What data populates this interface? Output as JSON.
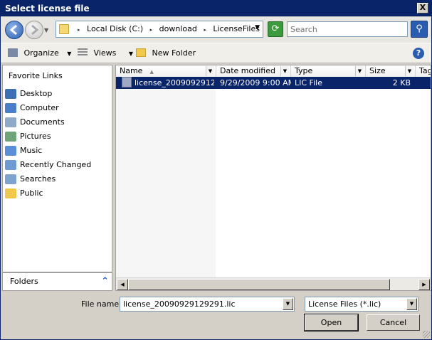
{
  "window": {
    "title": "Select license file",
    "close_label": "X"
  },
  "address": {
    "crumbs": [
      "Local Disk (C:)",
      "download",
      "LicenseFiles"
    ],
    "separator": "▸"
  },
  "search": {
    "placeholder": "Search"
  },
  "toolbar": {
    "organize_label": "Organize",
    "views_label": "Views",
    "new_folder_label": "New Folder",
    "help_label": "?"
  },
  "sidebar": {
    "header": "Favorite Links",
    "items": [
      {
        "label": "Desktop",
        "icon": "desktop-icon",
        "color": "#3d6fb5"
      },
      {
        "label": "Computer",
        "icon": "computer-icon",
        "color": "#4a7ec9"
      },
      {
        "label": "Documents",
        "icon": "documents-icon",
        "color": "#8fa9c7"
      },
      {
        "label": "Pictures",
        "icon": "pictures-icon",
        "color": "#6fa37a"
      },
      {
        "label": "Music",
        "icon": "music-icon",
        "color": "#5b8ed6"
      },
      {
        "label": "Recently Changed",
        "icon": "recently-changed-icon",
        "color": "#6d9ad0"
      },
      {
        "label": "Searches",
        "icon": "searches-icon",
        "color": "#7da4cf"
      },
      {
        "label": "Public",
        "icon": "public-folder-icon",
        "color": "#f0c94a"
      }
    ],
    "folders_label": "Folders"
  },
  "filelist": {
    "columns": [
      "Name",
      "Date modified",
      "Type",
      "Size",
      "Tag"
    ],
    "rows": [
      {
        "name": "license_2009092912...",
        "date": "9/29/2009 9:00 AM",
        "type": "LIC File",
        "size": "2 KB"
      }
    ]
  },
  "footer": {
    "filename_label": "File name:",
    "filename_value": "license_20090929129291.lic",
    "filetype_value": "License Files (*.lic)",
    "open_label": "Open",
    "cancel_label": "Cancel"
  },
  "colors": {
    "titlebar": "#0a246a",
    "selection": "#0a246a",
    "chrome": "#d4d0c8"
  }
}
